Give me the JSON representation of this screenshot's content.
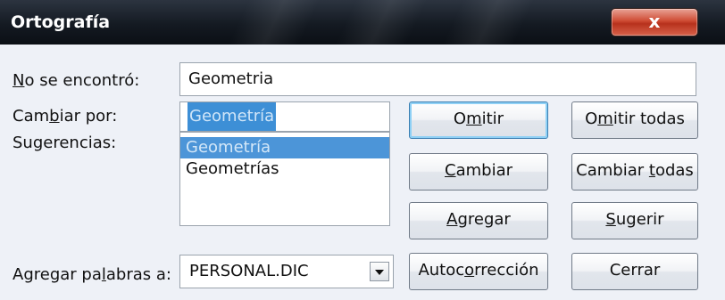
{
  "window": {
    "title": "Ortografía",
    "close_glyph": "x"
  },
  "labels": {
    "not_found_prefix": "N",
    "not_found_rest": "o se encontró:",
    "change_to_a": "Cam",
    "change_to_u": "b",
    "change_to_b": "iar por:",
    "suggestions": "Sugerencias:",
    "add_words_a": "Agregar pa",
    "add_words_u": "l",
    "add_words_b": "abras a:"
  },
  "fields": {
    "not_found_value": "Geometria",
    "change_to_value": "Geometría",
    "dictionary_value": "PERSONAL.DIC"
  },
  "suggestions": [
    "Geometría",
    "Geometrías"
  ],
  "buttons": {
    "omit": {
      "a": "O",
      "u": "m",
      "b": "itir"
    },
    "omit_all": {
      "a": "O",
      "u": "m",
      "b": "itir todas"
    },
    "change": {
      "a": "",
      "u": "C",
      "b": "ambiar"
    },
    "change_all": {
      "a": "Cambiar ",
      "u": "t",
      "b": "odas"
    },
    "add": {
      "a": "",
      "u": "A",
      "b": "gregar"
    },
    "suggest": {
      "a": "",
      "u": "S",
      "b": "ugerir"
    },
    "autocorrect": {
      "a": "Autoc",
      "u": "o",
      "b": "rrección"
    },
    "close": {
      "a": "Cerrar",
      "u": "",
      "b": ""
    }
  },
  "colors": {
    "selection": "#4c95d8",
    "titlebar": "#141a22",
    "close_button": "#cf4b33"
  }
}
